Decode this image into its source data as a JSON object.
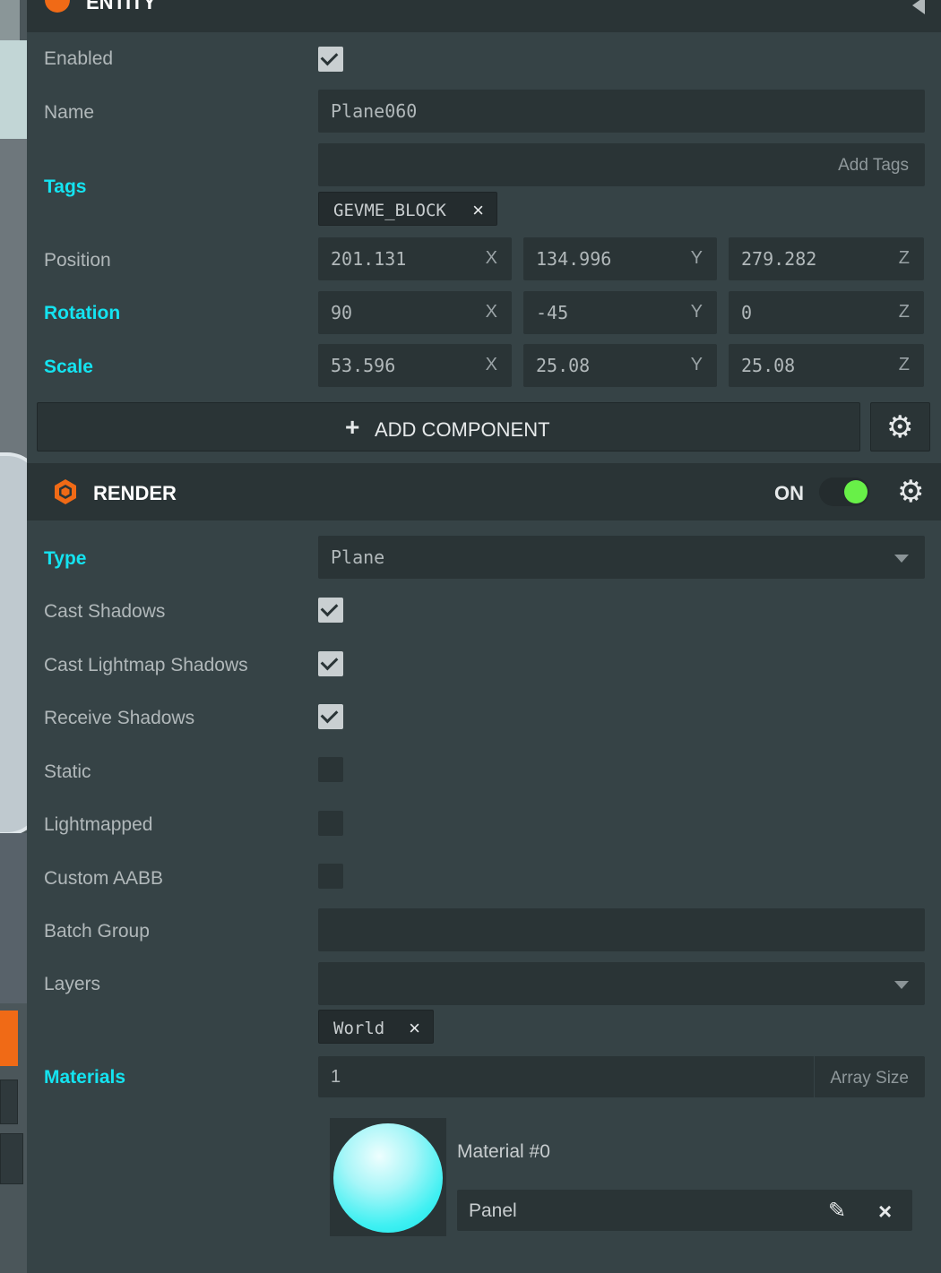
{
  "entity": {
    "title": "ENTITY",
    "enabled": {
      "label": "Enabled",
      "checked": true
    },
    "name": {
      "label": "Name",
      "value": "Plane060"
    },
    "tags": {
      "label": "Tags",
      "placeholder": "Add Tags",
      "items": [
        "GEVME_BLOCK"
      ],
      "remove": "×"
    },
    "position": {
      "label": "Position",
      "x": "201.131",
      "y": "134.996",
      "z": "279.282"
    },
    "rotation": {
      "label": "Rotation",
      "x": "90",
      "y": "-45",
      "z": "0"
    },
    "scale": {
      "label": "Scale",
      "x": "53.596",
      "y": "25.08",
      "z": "25.08"
    },
    "axes": {
      "x": "X",
      "y": "Y",
      "z": "Z"
    },
    "add_component": {
      "plus": "+",
      "label": "ADD COMPONENT"
    }
  },
  "render": {
    "title": "RENDER",
    "toggle_label": "ON",
    "toggle_on": true,
    "type": {
      "label": "Type",
      "value": "Plane"
    },
    "cast_shadows": {
      "label": "Cast Shadows",
      "checked": true
    },
    "cast_lightmap_shadows": {
      "label": "Cast Lightmap Shadows",
      "checked": true
    },
    "receive_shadows": {
      "label": "Receive Shadows",
      "checked": true
    },
    "static": {
      "label": "Static",
      "checked": false
    },
    "lightmapped": {
      "label": "Lightmapped",
      "checked": false
    },
    "custom_aabb": {
      "label": "Custom AABB",
      "checked": false
    },
    "batch_group": {
      "label": "Batch Group",
      "value": ""
    },
    "layers": {
      "label": "Layers",
      "items": [
        "World"
      ],
      "remove": "×"
    },
    "materials": {
      "label": "Materials",
      "count": "1",
      "array_size_label": "Array Size"
    },
    "material0": {
      "title": "Material #0",
      "value": "Panel",
      "edit": "✎",
      "remove": "×"
    }
  },
  "icons": {
    "gear": "⚙",
    "colors": {
      "accent": "#14e3f0",
      "brand": "#f06a16",
      "toggle": "#68f048"
    }
  }
}
